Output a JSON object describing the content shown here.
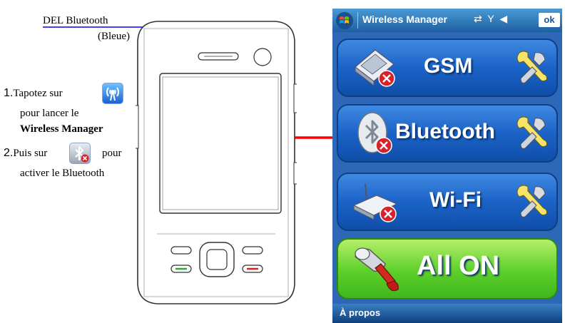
{
  "annotations": {
    "del_title": "DEL Bluetooth",
    "del_subtitle": "(Bleue)",
    "step1_num": "1.",
    "step1_prefix": "Tapotez sur",
    "step1_line2": "pour lancer le",
    "step1_bold": "Wireless Manager",
    "step2_num": "2.",
    "step2_prefix": "Puis sur",
    "step2_suffix": "pour",
    "step2_line2": "activer le Bluetooth",
    "icon_wireless_manager": "wireless-manager-icon",
    "icon_bluetooth_small": "bluetooth-off-icon"
  },
  "device_screen": {
    "title": "Wireless Manager",
    "ok_label": "ok",
    "status_icons": [
      "data-disconnected-icon",
      "signal-off-icon",
      "speaker-icon"
    ],
    "panels": [
      {
        "label": "GSM",
        "icon": "pda-phone-off-icon",
        "settings_icon": "wrench-icon"
      },
      {
        "label": "Bluetooth",
        "icon": "bluetooth-off-icon",
        "settings_icon": "wrench-icon"
      },
      {
        "label": "Wi-Fi",
        "icon": "wifi-router-off-icon",
        "settings_icon": "wrench-icon"
      },
      {
        "label": "All ON",
        "icon": "hammer-icon"
      }
    ],
    "bottom_label": "À propos"
  },
  "colors": {
    "annotation_line": "#0000ff",
    "pointer_arrow": "#ff0000",
    "panel_blue": "#1b63c8",
    "panel_green": "#5ccf2a",
    "error_badge": "#d8222a"
  }
}
